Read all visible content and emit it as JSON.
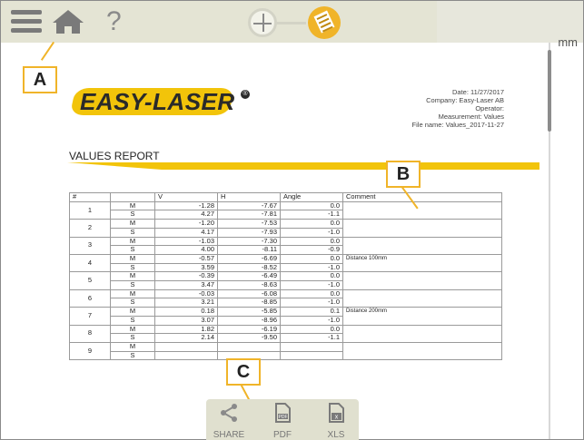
{
  "toolbar": {
    "menu_icon": "hamburger-menu-icon",
    "home_icon": "home-icon",
    "help_icon": "help-icon",
    "help_glyph": "?",
    "units": "mm"
  },
  "report": {
    "logo": "EASY-LASER",
    "logo_reg": "®",
    "meta": {
      "date": "Date: 11/27/2017",
      "company": "Company: Easy-Laser AB",
      "operator": "Operator:",
      "measurement": "Measurement: Values",
      "file_name": "File name: Values_2017-11-27"
    },
    "title": "VALUES REPORT",
    "table": {
      "headers": [
        "#",
        "",
        "V",
        "H",
        "Angle",
        "Comment"
      ],
      "groups": [
        {
          "id": "1",
          "rows": [
            [
              "M",
              "-1.28",
              "-7.67",
              "0.0"
            ],
            [
              "S",
              "4.27",
              "-7.81",
              "-1.1"
            ]
          ],
          "comment": ""
        },
        {
          "id": "2",
          "rows": [
            [
              "M",
              "-1.20",
              "-7.53",
              "0.0"
            ],
            [
              "S",
              "4.17",
              "-7.93",
              "-1.0"
            ]
          ],
          "comment": ""
        },
        {
          "id": "3",
          "rows": [
            [
              "M",
              "-1.03",
              "-7.30",
              "0.0"
            ],
            [
              "S",
              "4.00",
              "-8.11",
              "-0.9"
            ]
          ],
          "comment": ""
        },
        {
          "id": "4",
          "rows": [
            [
              "M",
              "-0.57",
              "-6.69",
              "0.0"
            ],
            [
              "S",
              "3.59",
              "-8.52",
              "-1.0"
            ]
          ],
          "comment": "Distance 100mm"
        },
        {
          "id": "5",
          "rows": [
            [
              "M",
              "-0.39",
              "-6.49",
              "0.0"
            ],
            [
              "S",
              "3.47",
              "-8.63",
              "-1.0"
            ]
          ],
          "comment": ""
        },
        {
          "id": "6",
          "rows": [
            [
              "M",
              "-0.03",
              "-6.08",
              "0.0"
            ],
            [
              "S",
              "3.21",
              "-8.85",
              "-1.0"
            ]
          ],
          "comment": ""
        },
        {
          "id": "7",
          "rows": [
            [
              "M",
              "0.18",
              "-5.85",
              "0.1"
            ],
            [
              "S",
              "3.07",
              "-8.96",
              "-1.0"
            ]
          ],
          "comment": "Distance 200mm"
        },
        {
          "id": "8",
          "rows": [
            [
              "M",
              "1.82",
              "-6.19",
              "0.0"
            ],
            [
              "S",
              "2.14",
              "-9.50",
              "-1.1"
            ]
          ],
          "comment": ""
        },
        {
          "id": "9",
          "rows": [
            [
              "M",
              "",
              "",
              ""
            ],
            [
              "S",
              "",
              "",
              ""
            ]
          ],
          "comment": ""
        }
      ]
    }
  },
  "callouts": {
    "a": "A",
    "b": "B",
    "c": "C"
  },
  "share_bar": {
    "share_label": "SHARE",
    "pdf_label": "PDF",
    "xls_label": "XLS",
    "pdf_badge": "PDF",
    "xls_badge": "x"
  },
  "colors": {
    "accent": "#f0b429",
    "logo_yellow": "#f2c40a",
    "toolbar_bg": "#e4e4d4"
  }
}
